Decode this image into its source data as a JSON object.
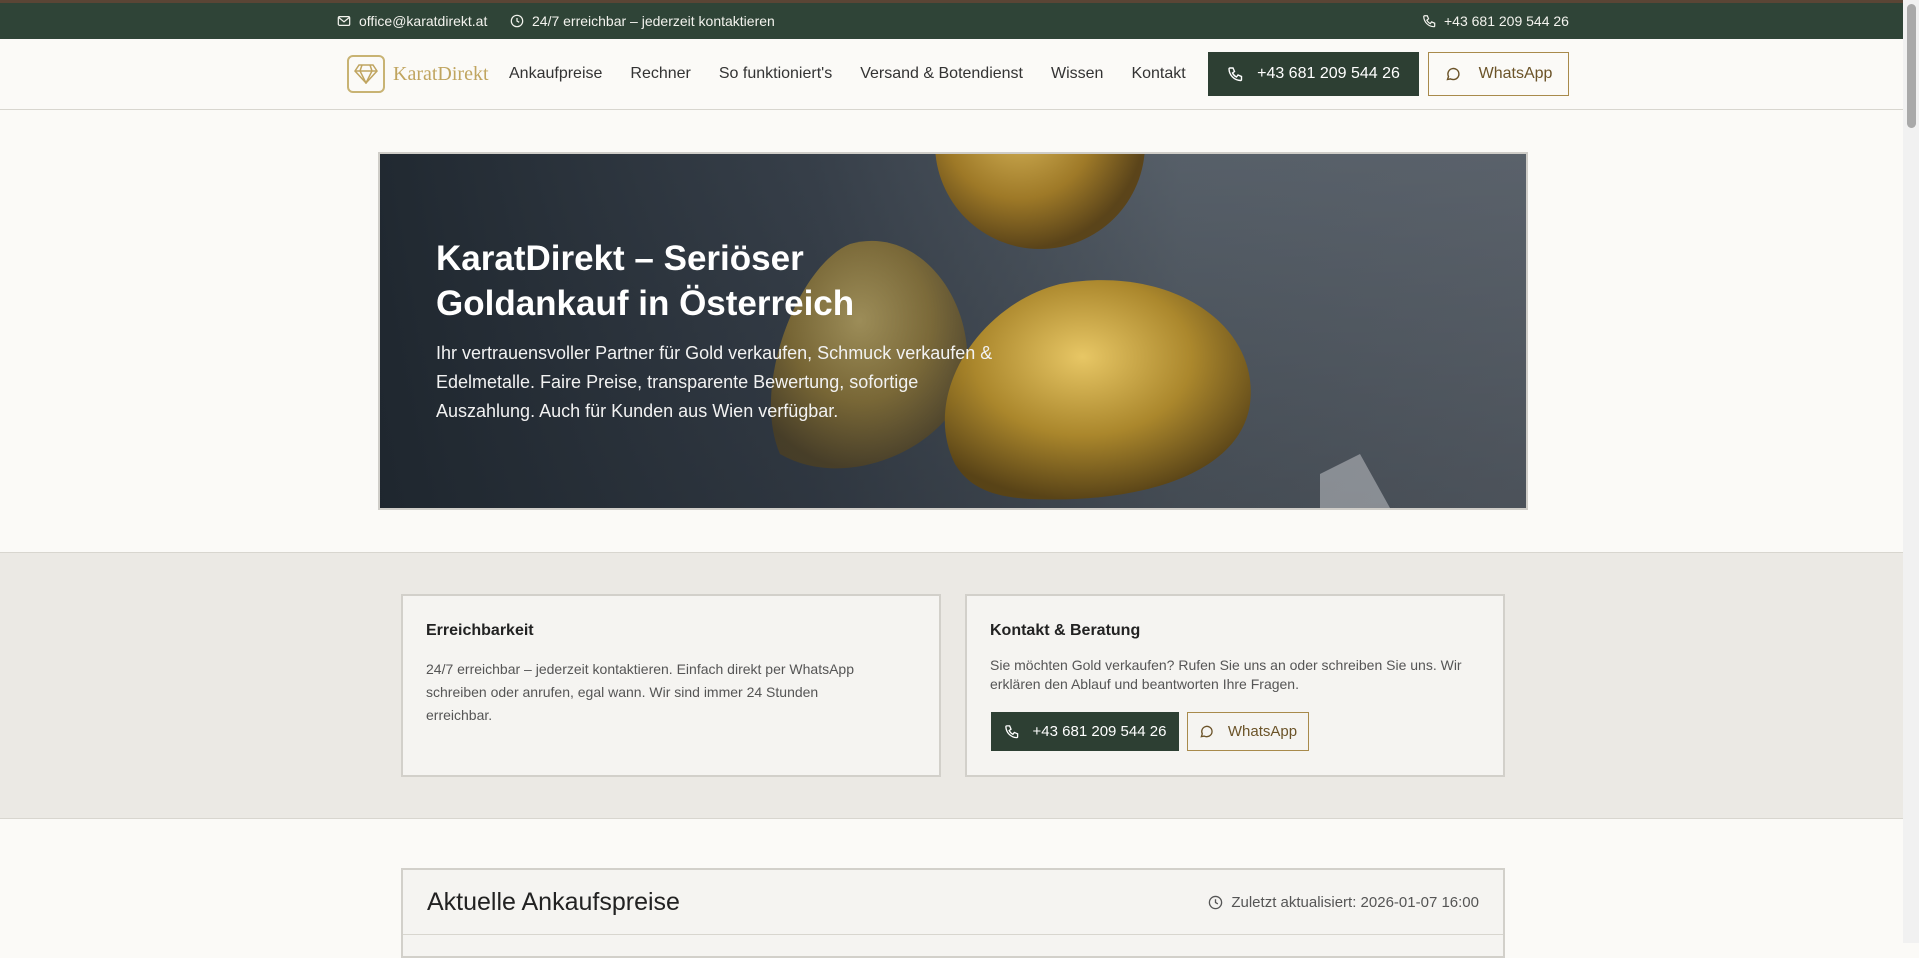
{
  "topbar": {
    "email": "office@karatdirekt.at",
    "hours": "24/7 erreichbar – jederzeit kontaktieren",
    "phone": "+43 681 209 544 26"
  },
  "header": {
    "logo_text": "KaratDirekt",
    "nav": [
      "Ankaufpreise",
      "Rechner",
      "So funktioniert's",
      "Versand & Botendienst",
      "Wissen",
      "Kontakt"
    ],
    "phone_button": "+43 681 209 544 26",
    "whatsapp_button": "WhatsApp"
  },
  "hero": {
    "title": "KaratDirekt – Seriöser Goldankauf in Österreich",
    "subtitle": "Ihr vertrauensvoller Partner für Gold verkaufen, Schmuck verkaufen & Edelmetalle. Faire Preise, transparente Bewertung, sofortige Auszahlung. Auch für Kunden aus Wien verfügbar."
  },
  "cards": {
    "availability": {
      "title": "Erreichbarkeit",
      "text": "24/7 erreichbar – jederzeit kontaktieren. Einfach direkt per WhatsApp schreiben oder anrufen, egal wann. Wir sind immer 24 Stunden erreichbar."
    },
    "contact": {
      "title": "Kontakt & Beratung",
      "text": "Sie möchten Gold verkaufen? Rufen Sie uns an oder schreiben Sie uns. Wir erklären den Ablauf und beantworten Ihre Fragen.",
      "phone_button": "+43 681 209 544 26",
      "whatsapp_button": "WhatsApp"
    }
  },
  "prices": {
    "title": "Aktuelle Ankaufspreise",
    "updated": "Zuletzt aktualisiert: 2026-01-07 16:00"
  },
  "colors": {
    "primary_green": "#2d3f33",
    "gold_accent": "#a88a4b",
    "background": "#fbfaf7"
  },
  "icons": [
    "mail-icon",
    "clock-icon",
    "phone-icon",
    "diamond-logo-icon",
    "chat-icon"
  ]
}
